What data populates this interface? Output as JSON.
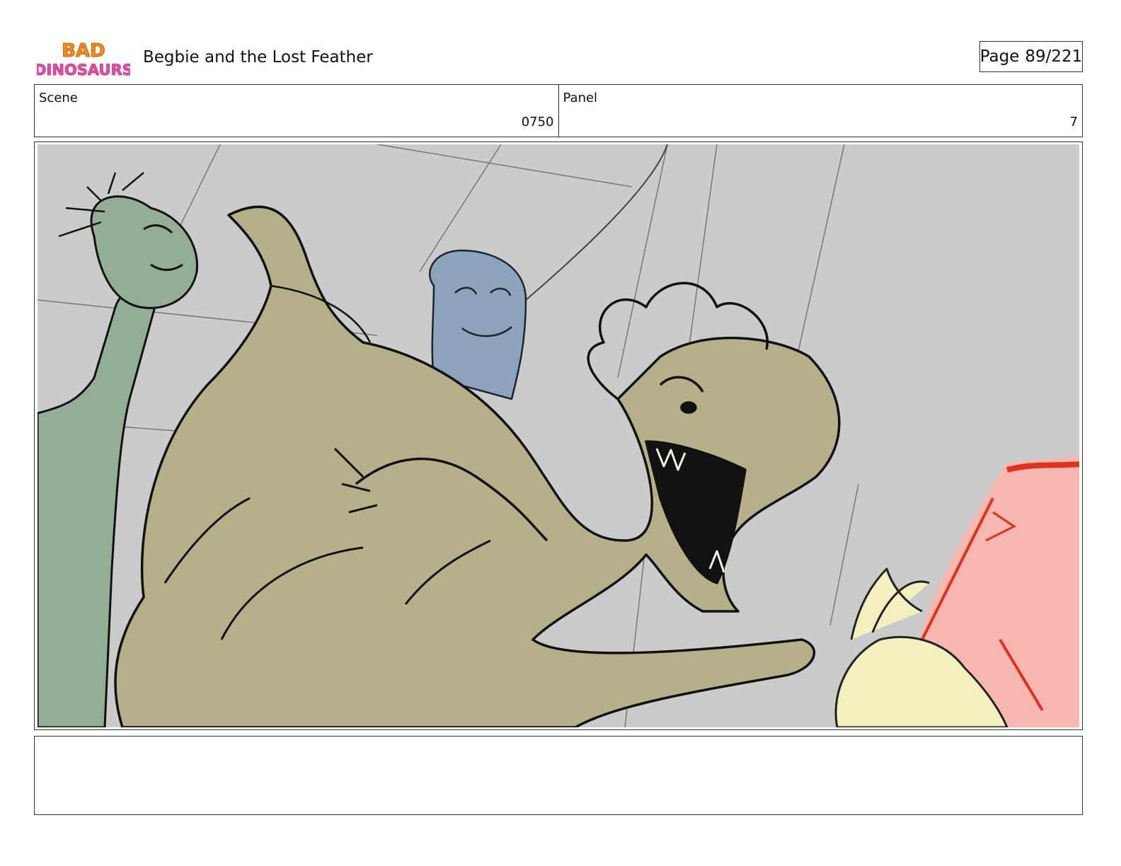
{
  "header": {
    "logo_line1": "BAD",
    "logo_line2": "DINOSAURS",
    "title": "Begbie and the Lost Feather",
    "page_label": "Page",
    "page_number": "89/221"
  },
  "info": {
    "scene_label": "Scene",
    "scene_value": "0750",
    "panel_label": "Panel",
    "panel_value": "7"
  },
  "colors": {
    "background": "#cbcbcb",
    "olive_dino": "#b5b08a",
    "green_dino": "#93ae95",
    "blue_dino": "#8ea4bd",
    "pink_figure": "#f6b7b1",
    "red_accent": "#e0301e",
    "yellow_figure": "#f4efbf"
  },
  "notes": ""
}
